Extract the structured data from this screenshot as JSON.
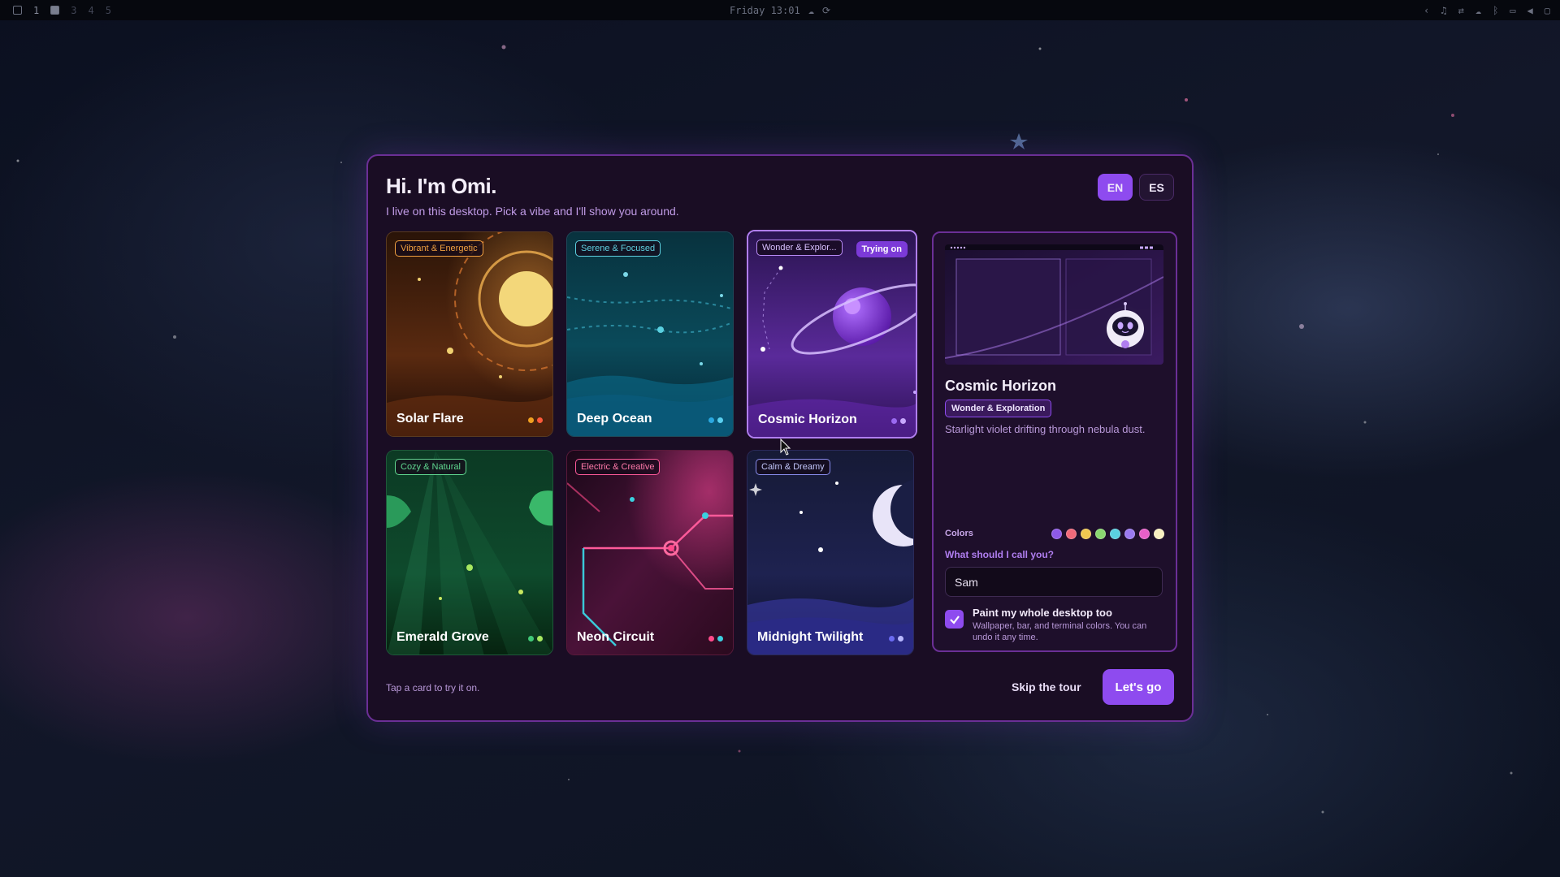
{
  "topbar": {
    "workspaces": [
      "1",
      "3",
      "4",
      "5"
    ],
    "clock": "Friday 13:01"
  },
  "dialog": {
    "title": "Hi. I'm Omi.",
    "subtitle": "I live on this desktop. Pick a vibe and I'll show you around.",
    "languages": [
      {
        "label": "EN",
        "active": true
      },
      {
        "label": "ES",
        "active": false
      }
    ],
    "themes": [
      {
        "name": "Solar Flare",
        "tag": "Vibrant & Energetic",
        "tag_color": "#f0a040",
        "dots": [
          "#f0a020",
          "#ff5a3a"
        ]
      },
      {
        "name": "Deep Ocean",
        "tag": "Serene & Focused",
        "tag_color": "#5fd0e0",
        "dots": [
          "#2aa8e0",
          "#5ad0f0"
        ]
      },
      {
        "name": "Cosmic Horizon",
        "tag": "Wonder & Explor...",
        "tag_color": "#b98cf5",
        "dots": [
          "#9a6af0",
          "#c8a8ff"
        ],
        "trying_label": "Trying on"
      },
      {
        "name": "Emerald Grove",
        "tag": "Cozy & Natural",
        "tag_color": "#60d890",
        "dots": [
          "#40c878",
          "#a8e860"
        ]
      },
      {
        "name": "Neon Circuit",
        "tag": "Electric & Creative",
        "tag_color": "#ff5a9a",
        "dots": [
          "#ff4a8a",
          "#3ad0e0"
        ]
      },
      {
        "name": "Midnight Twilight",
        "tag": "Calm & Dreamy",
        "tag_color": "#a0a8f0",
        "dots": [
          "#6a6af0",
          "#b8b8ff"
        ]
      }
    ],
    "preview": {
      "title": "Cosmic Horizon",
      "tag": "Wonder & Exploration",
      "description": "Starlight violet drifting through nebula dust.",
      "colors_label": "Colors",
      "colors": [
        "#8e5ae8",
        "#f06a7a",
        "#f0c850",
        "#8ad870",
        "#5ad0e0",
        "#9a7af0",
        "#e860c8",
        "#f8f0c0"
      ],
      "name_label": "What should I call you?",
      "name_value": "Sam",
      "paint_label": "Paint my whole desktop too",
      "paint_sub": "Wallpaper, bar, and terminal colors. You can undo it any time.",
      "paint_checked": true
    },
    "hint": "Tap a card to try it on.",
    "skip_label": "Skip the tour",
    "go_label": "Let's go"
  }
}
